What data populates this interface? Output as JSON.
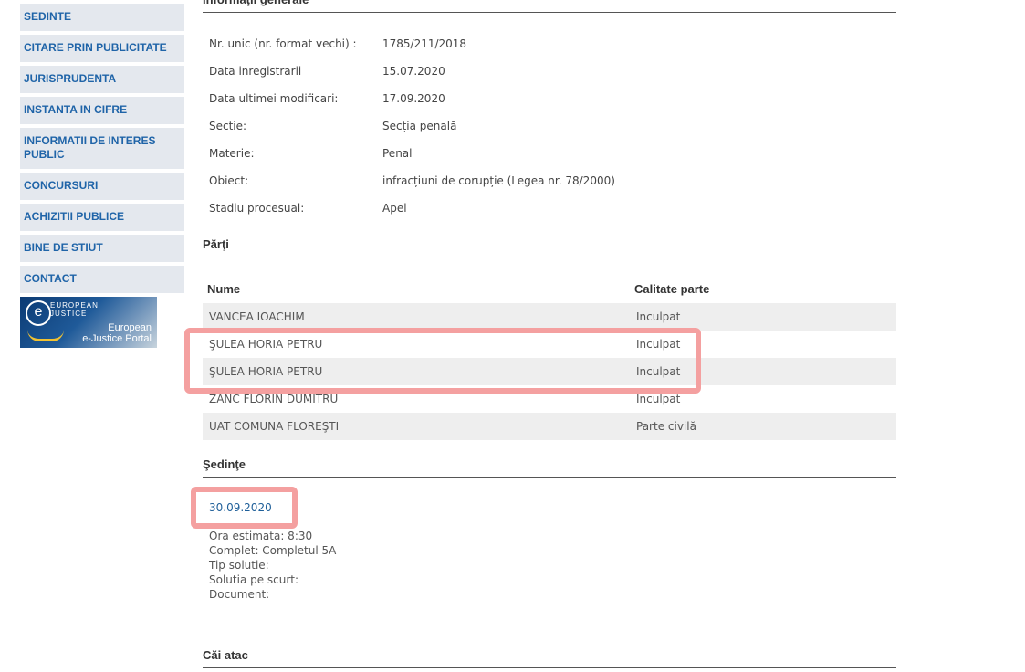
{
  "sidebar": {
    "items": [
      "SEDINTE",
      "CITARE PRIN PUBLICITATE",
      "JURISPRUDENTA",
      "INSTANTA IN CIFRE",
      "INFORMATII DE INTERES PUBLIC",
      "CONCURSURI",
      "ACHIZITII PUBLICE",
      "BINE DE STIUT",
      "CONTACT"
    ],
    "banner": {
      "mark": "e",
      "line1": "EUROPEAN",
      "line2": "JUSTICE",
      "portal1": "European",
      "portal2": "e-Justice Portal"
    }
  },
  "info": {
    "title": "Informaţii generale",
    "rows": [
      {
        "label": "Nr. unic (nr. format vechi) :",
        "value": "1785/211/2018"
      },
      {
        "label": "Data inregistrarii",
        "value": "15.07.2020"
      },
      {
        "label": "Data ultimei modificari:",
        "value": "17.09.2020"
      },
      {
        "label": "Sectie:",
        "value": "Secția penală"
      },
      {
        "label": "Materie:",
        "value": "Penal"
      },
      {
        "label": "Obiect:",
        "value": "infracțiuni de corupție (Legea nr. 78/2000)"
      },
      {
        "label": "Stadiu procesual:",
        "value": "Apel"
      }
    ]
  },
  "parti": {
    "title": "Părţi",
    "headers": {
      "nume": "Nume",
      "calitate": "Calitate parte"
    },
    "rows": [
      {
        "nume": "VANCEA IOACHIM",
        "calitate": "Inculpat"
      },
      {
        "nume": "ŞULEA HORIA PETRU",
        "calitate": "Inculpat"
      },
      {
        "nume": "ŞULEA HORIA PETRU",
        "calitate": "Inculpat"
      },
      {
        "nume": "ZANC FLORIN DUMITRU",
        "calitate": "Inculpat"
      },
      {
        "nume": "UAT COMUNA FLOREŞTI",
        "calitate": "Parte civilă"
      }
    ]
  },
  "sedinte": {
    "title": "Şedinţe",
    "date": "30.09.2020",
    "details": [
      "Ora estimata: 8:30",
      "Complet: Completul 5A",
      "Tip solutie:",
      "Solutia pe scurt:",
      "Document:"
    ]
  },
  "cai_atac": {
    "title": "Căi atac"
  }
}
